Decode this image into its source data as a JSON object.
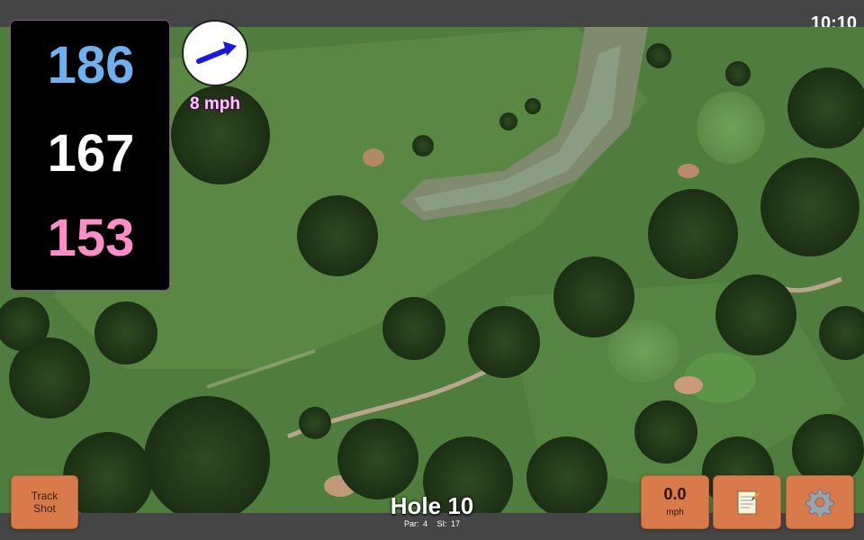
{
  "status_bar": {
    "time": "10:10"
  },
  "distances": {
    "back": "186",
    "center": "167",
    "front": "153"
  },
  "wind": {
    "speed_label": "8 mph",
    "direction_icon": "wind-arrow-icon"
  },
  "hole": {
    "title": "Hole 10",
    "par_label": "Par: 4",
    "si_label": "SI: 17"
  },
  "buttons": {
    "track_shot_line1": "Track",
    "track_shot_line2": "Shot",
    "speed_value": "0.0",
    "speed_unit": "mph",
    "notes_icon": "notepad-icon",
    "settings_icon": "gear-icon"
  },
  "colors": {
    "back_distance": "#6fb0ee",
    "center_distance": "#ffffff",
    "front_distance": "#ff8ec8",
    "button_accent": "#d97a4b",
    "wind_label": "#ffc7ff"
  }
}
